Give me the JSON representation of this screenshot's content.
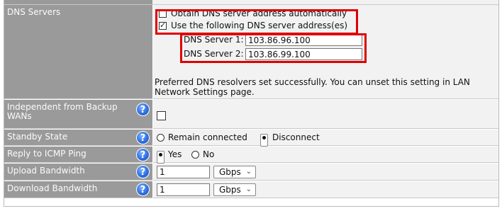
{
  "dns": {
    "label": "DNS Servers",
    "auto_label": "Obtain DNS server address automatically",
    "auto_checked": false,
    "manual_label": "Use the following DNS server address(es)",
    "manual_checked": true,
    "server1_label": "DNS Server 1:",
    "server1_value": "103.86.96.100",
    "server2_label": "DNS Server 2:",
    "server2_value": "103.86.99.100",
    "note": "Preferred DNS resolvers set successfully. You can unset this setting in LAN Network Settings page."
  },
  "independent": {
    "label": "Independent from Backup WANs",
    "checked": false
  },
  "standby": {
    "label": "Standby State",
    "options": [
      "Remain connected",
      "Disconnect"
    ],
    "selected": "Disconnect"
  },
  "icmp": {
    "label": "Reply to ICMP Ping",
    "options": [
      "Yes",
      "No"
    ],
    "selected": "Yes"
  },
  "upload": {
    "label": "Upload Bandwidth",
    "value": "1",
    "unit": "Gbps"
  },
  "download": {
    "label": "Download Bandwidth",
    "value": "1",
    "unit": "Gbps"
  },
  "colors": {
    "label_bg": "#9a9a9a",
    "value_bg": "#f2f2f2",
    "highlight": "#e00000",
    "help_icon": "#2f6fe0"
  },
  "icons": {
    "help": "help-icon"
  }
}
